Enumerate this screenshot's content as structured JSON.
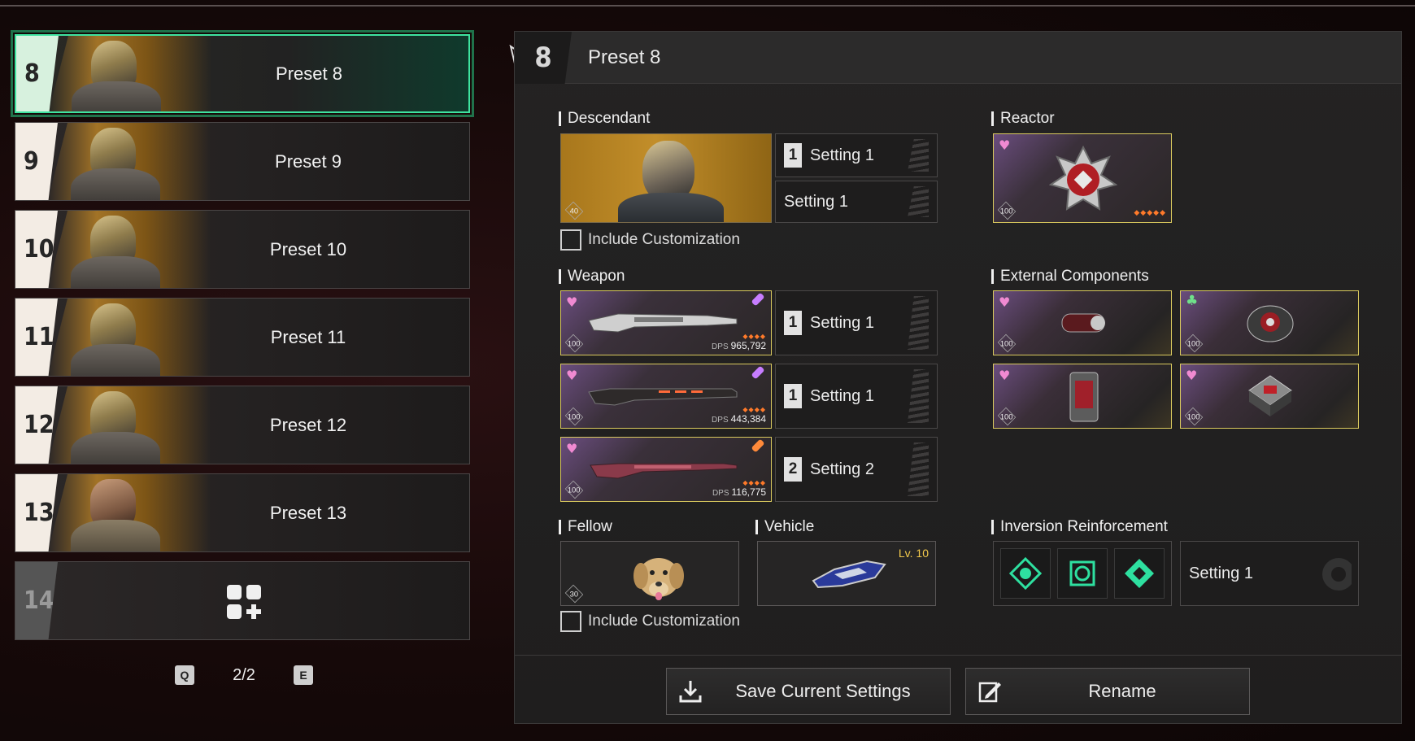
{
  "presets": [
    {
      "num": "8",
      "label": "Preset 8",
      "selected": true
    },
    {
      "num": "9",
      "label": "Preset 9"
    },
    {
      "num": "10",
      "label": "Preset 10"
    },
    {
      "num": "11",
      "label": "Preset 11"
    },
    {
      "num": "12",
      "label": "Preset 12"
    },
    {
      "num": "13",
      "label": "Preset 13"
    },
    {
      "num": "14",
      "label": "",
      "empty": true
    }
  ],
  "pager": {
    "prev_key": "Q",
    "page": "2/2",
    "next_key": "E"
  },
  "panel": {
    "number": "8",
    "title": "Preset 8",
    "descendant": {
      "section": "Descendant",
      "level": "40",
      "setting_num": "1",
      "setting_1": "Setting 1",
      "setting_2": "Setting 1",
      "include_customization": "Include Customization"
    },
    "reactor": {
      "section": "Reactor",
      "level": "100"
    },
    "weapon": {
      "section": "Weapon",
      "items": [
        {
          "level": "100",
          "dps_label": "DPS",
          "dps": "965,792",
          "setting_num": "1",
          "setting": "Setting 1",
          "pip_color": "#c77dff"
        },
        {
          "level": "100",
          "dps_label": "DPS",
          "dps": "443,384",
          "setting_num": "1",
          "setting": "Setting 1",
          "pip_color": "#c77dff"
        },
        {
          "level": "100",
          "dps_label": "DPS",
          "dps": "116,775",
          "setting_num": "2",
          "setting": "Setting 2",
          "pip_color": "#ff8a3a"
        }
      ]
    },
    "external": {
      "section": "External Components",
      "items": [
        {
          "level": "100",
          "mark": "heart"
        },
        {
          "level": "100",
          "mark": "club"
        },
        {
          "level": "100",
          "mark": "heart"
        },
        {
          "level": "100",
          "mark": "heart"
        }
      ]
    },
    "fellow": {
      "section": "Fellow",
      "level": "30",
      "include_customization": "Include Customization"
    },
    "vehicle": {
      "section": "Vehicle",
      "level": "Lv. 10"
    },
    "inversion": {
      "section": "Inversion Reinforcement",
      "setting": "Setting 1"
    },
    "buttons": {
      "save": "Save Current Settings",
      "rename": "Rename"
    }
  },
  "colors": {
    "accent_green": "#3fe3a0",
    "gold_border": "#d9c95e",
    "heart_pink": "#f08ad2",
    "star_orange": "#ff7a2a",
    "inversion_green": "#2ee0a0"
  }
}
